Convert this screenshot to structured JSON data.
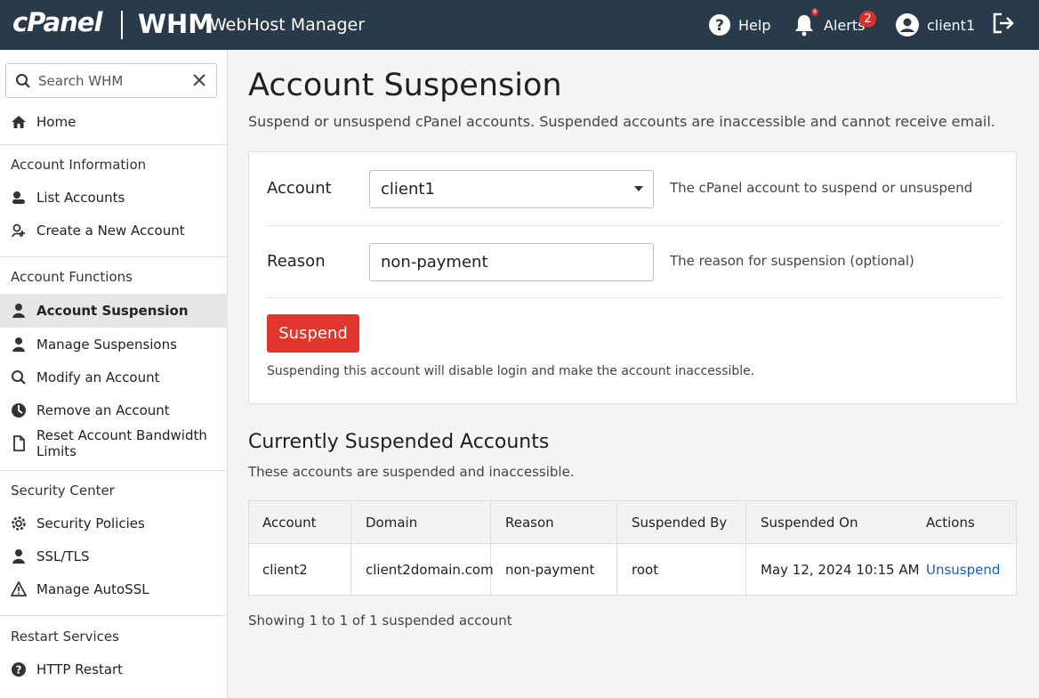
{
  "header": {
    "brand_cpanel": "cPanel",
    "brand_whm": "WHM",
    "brand_subtitle": "WebHost Manager",
    "help_label": "Help",
    "alerts_label": "Alerts",
    "alerts_count": "2",
    "bell_count": "8",
    "user_label": "client1"
  },
  "sidebar": {
    "search_placeholder": "Search WHM",
    "home": "Home",
    "sections": [
      {
        "heading": "Account Information",
        "items": [
          "List Accounts",
          "Create a New Account"
        ]
      },
      {
        "heading": "Account Functions",
        "items": [
          "Account Suspension",
          "Manage Suspensions",
          "Modify an Account",
          "Remove an Account",
          "Reset Account Bandwidth Limits"
        ]
      },
      {
        "heading": "Security Center",
        "items": [
          "Security Policies",
          "SSL/TLS",
          "Manage AutoSSL"
        ]
      },
      {
        "heading": "Restart Services",
        "items": [
          "HTTP Restart"
        ]
      }
    ],
    "active_item": "Account Suspension"
  },
  "main": {
    "title": "Account Suspension",
    "description": "Suspend or unsuspend cPanel accounts. Suspended accounts are inaccessible and cannot receive email.",
    "form": {
      "account_label": "Account",
      "account_value": "client1",
      "account_help": "The cPanel account to suspend or unsuspend",
      "reason_label": "Reason",
      "reason_value": "non-payment",
      "reason_help": "The reason for suspension (optional)",
      "submit_label": "Suspend",
      "note": "Suspending this account will disable login and make the account inaccessible."
    },
    "suspended": {
      "title": "Currently Suspended Accounts",
      "description": "These accounts are suspended and inaccessible.",
      "columns": [
        "Account",
        "Domain",
        "Reason",
        "Suspended By",
        "Suspended On",
        "Actions"
      ],
      "rows": [
        {
          "account": "client2",
          "domain": "client2domain.com",
          "reason": "non-payment",
          "suspended_by": "root",
          "suspended_on": "May 12, 2024 10:15 AM",
          "action": "Unsuspend"
        }
      ],
      "footer": "Showing 1 to 1 of 1 suspended account"
    }
  },
  "colors": {
    "topbar": "#293a4a",
    "danger": "#e2362c",
    "link": "#1a5fb4"
  }
}
